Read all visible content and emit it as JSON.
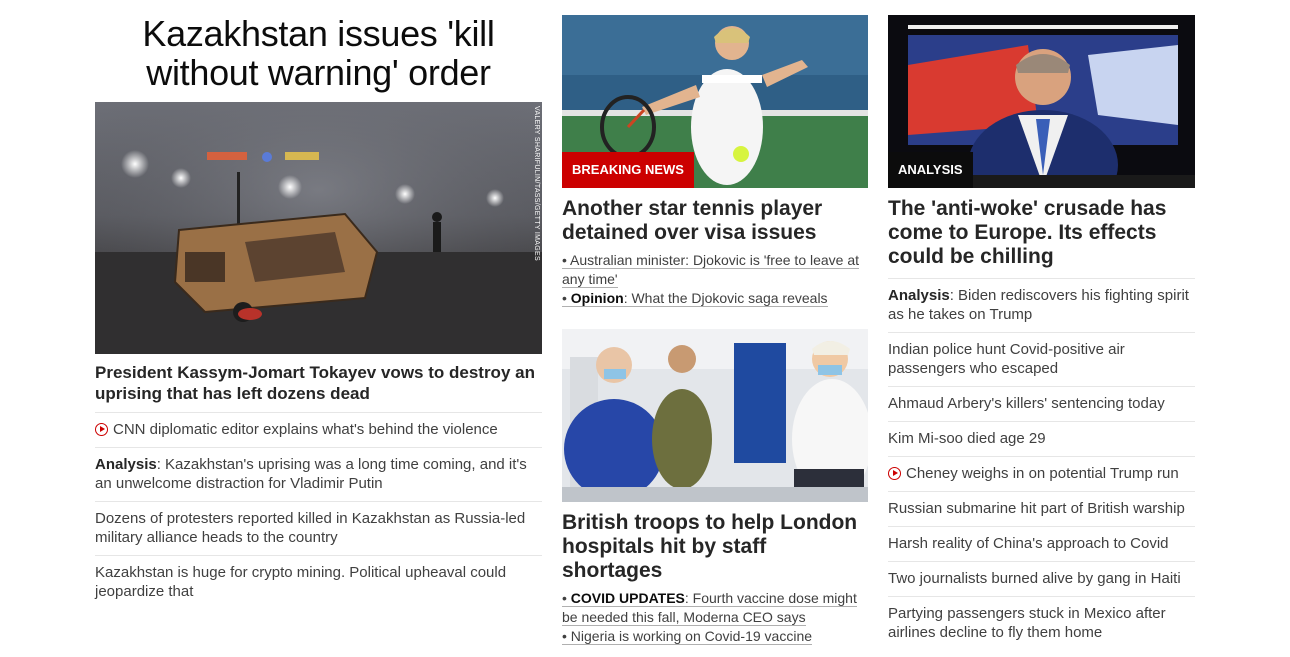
{
  "lead": {
    "headline": "Kazakhstan issues 'kill without warning' order",
    "image_credit": "VALERY SHARIFULIN/TASS/GETTY IMAGES",
    "title": "President Kassym-Jomart Tokayev vows to destroy an uprising that has left dozens dead",
    "items": [
      {
        "prefix": "",
        "text": "CNN diplomatic editor explains what's behind the violence",
        "video": true
      },
      {
        "prefix": "Analysis",
        "text": ": Kazakhstan's uprising was a long time coming, and it's an unwelcome distraction for Vladimir Putin",
        "video": false
      },
      {
        "prefix": "",
        "text": "Dozens of protesters reported killed in Kazakhstan as Russia-led military alliance heads to the country",
        "video": false
      },
      {
        "prefix": "",
        "text": "Kazakhstan is huge for crypto mining. Political upheaval could jeopardize that",
        "video": false
      }
    ]
  },
  "tennis": {
    "label": "Breaking News",
    "title": "Another star tennis player detained over visa issues",
    "sub1": "• Australian minister: Djokovic is 'free to leave at any time'",
    "sub2_prefix": "Opinion",
    "sub2_text": ": What the Djokovic saga reveals"
  },
  "troops": {
    "title": "British troops to help London hospitals hit by staff shortages",
    "sub1_prefix": "COVID UPDATES",
    "sub1_text": ": Fourth vaccine dose might be needed this fall, Moderna CEO says",
    "sub2": "• Nigeria is working on Covid-19 vaccine"
  },
  "antiwoke": {
    "label": "Analysis",
    "title": "The 'anti-woke' crusade has come to Europe. Its effects could be chilling",
    "items": [
      {
        "prefix": "Analysis",
        "text": ": Biden rediscovers his fighting spirit as he takes on Trump",
        "video": false
      },
      {
        "prefix": "",
        "text": "Indian police hunt Covid-positive air passengers who escaped",
        "video": false
      },
      {
        "prefix": "",
        "text": "Ahmaud Arbery's killers' sentencing today",
        "video": false
      },
      {
        "prefix": "",
        "text": "Kim Mi-soo died age 29",
        "video": false
      },
      {
        "prefix": "",
        "text": "Cheney weighs in on potential Trump run",
        "video": true
      },
      {
        "prefix": "",
        "text": "Russian submarine hit part of British warship",
        "video": false
      },
      {
        "prefix": "",
        "text": "Harsh reality of China's approach to Covid",
        "video": false
      },
      {
        "prefix": "",
        "text": "Two journalists burned alive by gang in Haiti",
        "video": false
      },
      {
        "prefix": "",
        "text": "Partying passengers stuck in Mexico after airlines decline to fly them home",
        "video": false
      }
    ]
  },
  "colors": {
    "accent_red": "#cc0000",
    "label_dark": "#0c0c0c",
    "text": "#262626"
  }
}
